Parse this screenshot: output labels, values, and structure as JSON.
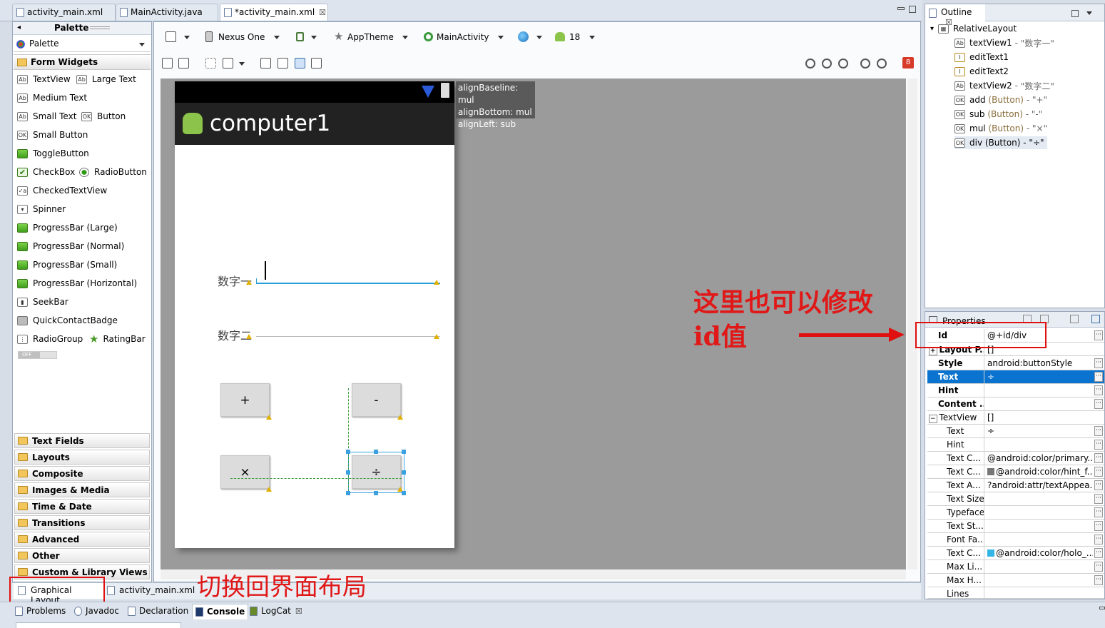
{
  "editor_tabs": [
    {
      "label": "activity_main.xml",
      "active": false
    },
    {
      "label": "MainActivity.java",
      "active": false
    },
    {
      "label": "*activity_main.xml",
      "active": true
    }
  ],
  "palette": {
    "header": "Palette",
    "selector_label": "Palette",
    "open_category": "Form Widgets",
    "widgets": [
      [
        "TextView",
        "Large Text"
      ],
      [
        "Medium Text"
      ],
      [
        "Small Text",
        "Button"
      ],
      [
        "Small Button"
      ],
      [
        "ToggleButton"
      ],
      [
        "CheckBox",
        "RadioButton"
      ],
      [
        "CheckedTextView"
      ],
      [
        "Spinner"
      ],
      [
        "ProgressBar (Large)"
      ],
      [
        "ProgressBar (Normal)"
      ],
      [
        "ProgressBar (Small)"
      ],
      [
        "ProgressBar (Horizontal)"
      ],
      [
        "SeekBar"
      ],
      [
        "QuickContactBadge"
      ],
      [
        "RadioGroup",
        "RatingBar"
      ]
    ],
    "switch_label": "OFF",
    "categories": [
      "Text Fields",
      "Layouts",
      "Composite",
      "Images & Media",
      "Time & Date",
      "Transitions",
      "Advanced",
      "Other",
      "Custom & Library Views"
    ]
  },
  "toolbar": {
    "device": "Nexus One",
    "theme": "AppTheme",
    "activity": "MainActivity",
    "api_level": "18",
    "error_count": "8"
  },
  "device_screen": {
    "app_title": "computer1",
    "label1": "数字一",
    "label2": "数字二",
    "buttons": [
      "+",
      "-",
      "×",
      "÷"
    ],
    "tooltip_lines": [
      "alignBaseline: mul",
      "alignBottom: mul",
      "alignLeft: sub"
    ]
  },
  "bottom_editor_tabs": [
    "Graphical Layout",
    "activity_main.xml"
  ],
  "outline": {
    "title": "Outline",
    "root": "RelativeLayout",
    "items": [
      {
        "name": "textView1",
        "type": "",
        "text": "\"数字一\""
      },
      {
        "name": "editText1",
        "type": "",
        "text": ""
      },
      {
        "name": "editText2",
        "type": "",
        "text": ""
      },
      {
        "name": "textView2",
        "type": "",
        "text": "\"数字二\""
      },
      {
        "name": "add",
        "type": "(Button)",
        "text": "\"+\""
      },
      {
        "name": "sub",
        "type": "(Button)",
        "text": "\"-\""
      },
      {
        "name": "mul",
        "type": "(Button)",
        "text": "\"×\""
      },
      {
        "name": "div",
        "type": "(Button)",
        "text": "\"÷\""
      }
    ]
  },
  "properties": {
    "title": "Properties",
    "rows": [
      {
        "key": "Id",
        "value": "@+id/div"
      },
      {
        "key": "Layout P...",
        "value": "[]"
      },
      {
        "key": "Style",
        "value": "android:buttonStyle"
      },
      {
        "key": "Text",
        "value": "÷"
      },
      {
        "key": "Hint",
        "value": ""
      },
      {
        "key": "Content ...",
        "value": ""
      },
      {
        "key": "TextView",
        "value": "[]"
      },
      {
        "key": "Text",
        "value": "÷"
      },
      {
        "key": "Hint",
        "value": ""
      },
      {
        "key": "Text C...",
        "value": "@android:color/primary..."
      },
      {
        "key": "Text C...",
        "value": "@android:color/hint_f..."
      },
      {
        "key": "Text A...",
        "value": "?android:attr/textAppea..."
      },
      {
        "key": "Text Size",
        "value": ""
      },
      {
        "key": "Typeface",
        "value": ""
      },
      {
        "key": "Text St...",
        "value": ""
      },
      {
        "key": "Font Fa...",
        "value": ""
      },
      {
        "key": "Text C...",
        "value": "@android:color/holo_..."
      },
      {
        "key": "Max Li...",
        "value": ""
      },
      {
        "key": "Max H...",
        "value": ""
      },
      {
        "key": "Lines",
        "value": ""
      }
    ]
  },
  "annotations": {
    "id_note_line1": "这里也可以修改",
    "id_note_line2": "id值",
    "layout_note": "切换回界面布局"
  },
  "bottom_views": [
    "Problems",
    "Javadoc",
    "Declaration",
    "Console",
    "LogCat"
  ],
  "colors": {
    "selection": "#0a73d0",
    "annotation_red": "#e01010",
    "canvas_grey": "#9b9b9b",
    "action_bar": "#222222"
  }
}
